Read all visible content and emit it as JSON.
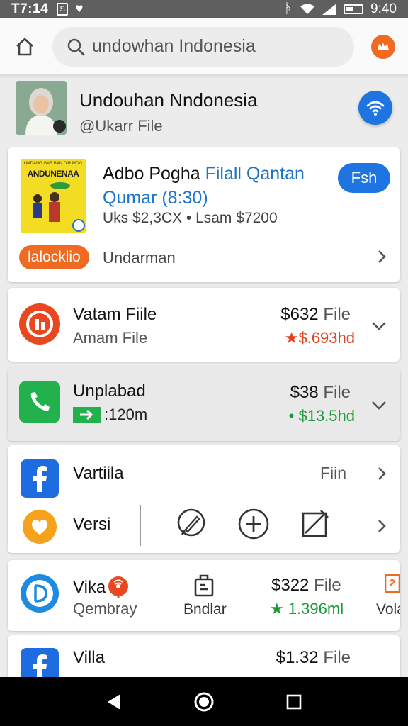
{
  "status_bar": {
    "time": "T7:14",
    "left_badge": "S",
    "clock": "9:40"
  },
  "search": {
    "query": "undowhan Indonesia"
  },
  "profile": {
    "name": "Undouhan Nndonesia",
    "handle": "@Ukarr File"
  },
  "featured": {
    "thumb_small": "UNDANG GAS BAN DIR MOG",
    "thumb_text": "ANDUNENAA",
    "title_black": "Adbo Pogha",
    "title_blue": "Filall Qantan Qumar (8:30)",
    "meta": "Uks $2,3CX • Lsam $7200",
    "action": "Fsh",
    "tag": "lalocklio",
    "link": "Undarman"
  },
  "rows": [
    {
      "title": "Vatam Fiile",
      "sub": "Amam File",
      "price": "$632",
      "price_unit": "File",
      "rating": "★$.693hd",
      "rating_color": "#e0401c"
    },
    {
      "title": "Unplabad",
      "sub": ":120m",
      "price": "$38",
      "price_unit": "File",
      "rating": "• $13.5hd",
      "rating_color": "#1d9a3a"
    }
  ],
  "mixed_card": {
    "item1_title": "Vartiila",
    "item1_right": "Fiin",
    "item2_title": "Versi"
  },
  "vika_card": {
    "title": "Vika",
    "sub": "Qembray",
    "mid_label": "Bndlar",
    "price": "$322",
    "price_unit": "File",
    "rating": "★ 1.396ml",
    "rating_color": "#1d9a3a",
    "right_label": "Volar"
  },
  "villa_card": {
    "title": "Villa",
    "price": "$1.32",
    "price_unit": "File"
  },
  "colors": {
    "accent_blue": "#1e74e0",
    "accent_orange": "#f06a22",
    "green": "#22b14c"
  }
}
